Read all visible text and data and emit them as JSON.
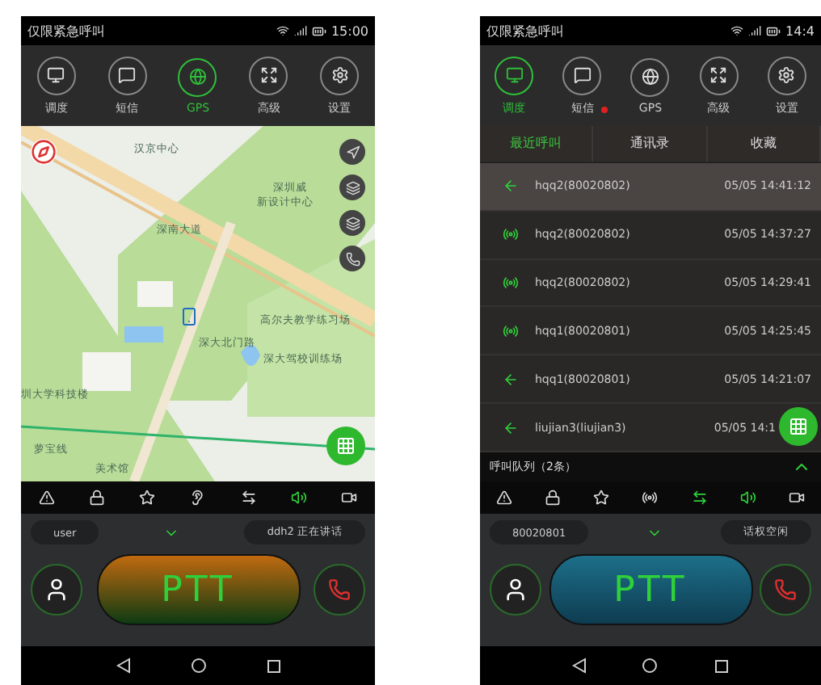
{
  "phones": [
    {
      "status": {
        "app": "仅限紧急呼叫",
        "time": "15:00"
      },
      "nav": [
        {
          "label": "调度",
          "selected": false,
          "badge": false
        },
        {
          "label": "短信",
          "selected": false,
          "badge": false
        },
        {
          "label": "GPS",
          "selected": true,
          "badge": false
        },
        {
          "label": "高级",
          "selected": false,
          "badge": false
        },
        {
          "label": "设置",
          "selected": false,
          "badge": false
        }
      ],
      "kind": "map",
      "map": {
        "labels": [
          "汉京中心",
          "深圳威",
          "新设计中心",
          "深南大道",
          "高尔夫教学练习场",
          "深大北门路",
          "深大驾校训练场",
          "圳大学科技楼",
          "萝宝线",
          "美术馆"
        ]
      },
      "toolbar": [
        {
          "on": false
        },
        {
          "on": false
        },
        {
          "on": false
        },
        {
          "on": false
        },
        {
          "on": false
        },
        {
          "on": true
        },
        {
          "on": false
        }
      ],
      "panel": {
        "left_field": "user",
        "right_field": "ddh2 正在讲话",
        "ptt": {
          "label": "PTT",
          "talking": true
        }
      }
    },
    {
      "status": {
        "app": "仅限紧急呼叫",
        "time": "14:4"
      },
      "nav": [
        {
          "label": "调度",
          "selected": true,
          "badge": false
        },
        {
          "label": "短信",
          "selected": false,
          "badge": true
        },
        {
          "label": "GPS",
          "selected": false,
          "badge": false
        },
        {
          "label": "高级",
          "selected": false,
          "badge": false
        },
        {
          "label": "设置",
          "selected": false,
          "badge": false
        }
      ],
      "kind": "calls",
      "tabs": [
        {
          "label": "最近呼叫",
          "selected": true
        },
        {
          "label": "通讯录",
          "selected": false
        },
        {
          "label": "收藏",
          "selected": false
        }
      ],
      "calls": [
        {
          "kind": "arrow",
          "name": "hqq2(80020802)",
          "time": "05/05 14:41:12",
          "selected": true
        },
        {
          "kind": "dot",
          "name": "hqq2(80020802)",
          "time": "05/05 14:37:27",
          "selected": false
        },
        {
          "kind": "dot",
          "name": "hqq2(80020802)",
          "time": "05/05 14:29:41",
          "selected": false
        },
        {
          "kind": "dot",
          "name": "hqq1(80020801)",
          "time": "05/05 14:25:45",
          "selected": false
        },
        {
          "kind": "arrow",
          "name": "hqq1(80020801)",
          "time": "05/05 14:21:07",
          "selected": false
        },
        {
          "kind": "arrow",
          "name": "liujian3(liujian3)",
          "time": "05/05 14:1",
          "selected": false
        }
      ],
      "queue": "呼叫队列（2条）",
      "toolbar": [
        {
          "on": false
        },
        {
          "on": false
        },
        {
          "on": false
        },
        {
          "on": false
        },
        {
          "on": true
        },
        {
          "on": true
        },
        {
          "on": false
        }
      ],
      "panel": {
        "left_field": "80020801",
        "right_field": "话权空闲",
        "ptt": {
          "label": "PTT",
          "talking": false
        }
      }
    }
  ]
}
